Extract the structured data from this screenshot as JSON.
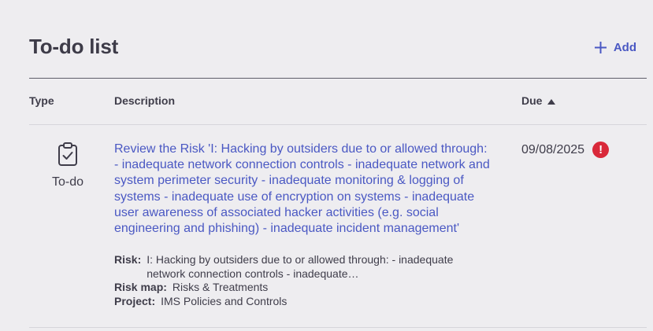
{
  "header": {
    "title": "To-do list",
    "add_label": "Add",
    "add_icon": "plus-icon",
    "accent_color": "#4a58c3"
  },
  "columns": {
    "type": "Type",
    "description": "Description",
    "due": "Due",
    "due_sort_icon": "sort-ascending-icon"
  },
  "rows": [
    {
      "type_icon": "clipboard-check-icon",
      "type_label": "To-do",
      "description": "Review the Risk 'I: Hacking by outsiders due to or allowed through: - inadequate network connection controls - inadequate network and system perimeter security - inadequate monitoring & logging of systems - inadequate use of encryption on systems - inadequate user awareness of associated hacker activities (e.g. social engineering and phishing) - inadequate incident management'",
      "risk_key": "Risk:",
      "risk_value": "I: Hacking by outsiders due to or allowed through: - inadequate network connection controls - inadequate…",
      "risk_map_key": "Risk map:",
      "risk_map_value": "Risks & Treatments",
      "project_key": "Project:",
      "project_value": "IMS Policies and Controls",
      "due_date": "09/08/2025",
      "overdue_icon": "alert-icon",
      "overdue_glyph": "!",
      "overdue_color": "#d9293a"
    }
  ]
}
